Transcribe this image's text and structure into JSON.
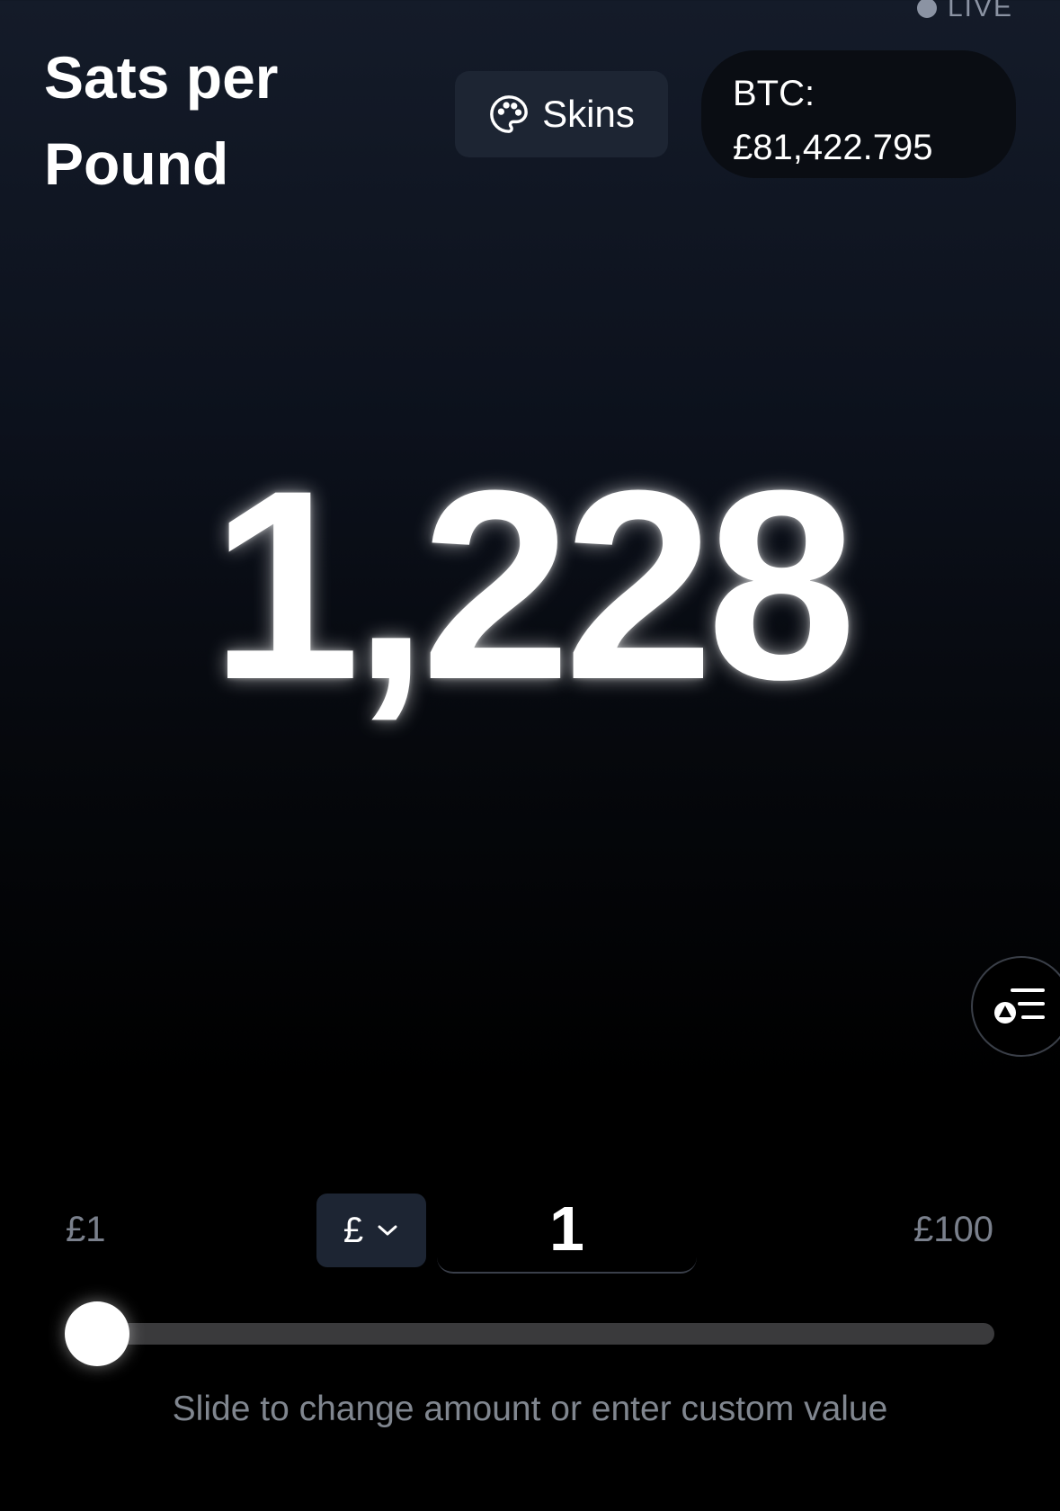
{
  "status": {
    "label": "LIVE"
  },
  "header": {
    "title_line1": "Sats per",
    "title_line2": "Pound",
    "skins_label": "Skins",
    "btc_label": "BTC:",
    "btc_price": "£81,422.795"
  },
  "main": {
    "sats_value": "1,228"
  },
  "controls": {
    "range_min": "£1",
    "range_max": "£100",
    "currency_symbol": "£",
    "amount_value": "1",
    "slider_fraction": 0,
    "hint": "Slide to change amount or enter custom value"
  },
  "icons": {
    "skins": "palette-icon",
    "currency": "chevron-down-icon",
    "fab": "shapes-list-icon"
  },
  "colors": {
    "background_top": "#141b29",
    "background_bottom": "#000000",
    "button_bg": "#1d2533",
    "muted_text": "#7a808c"
  }
}
